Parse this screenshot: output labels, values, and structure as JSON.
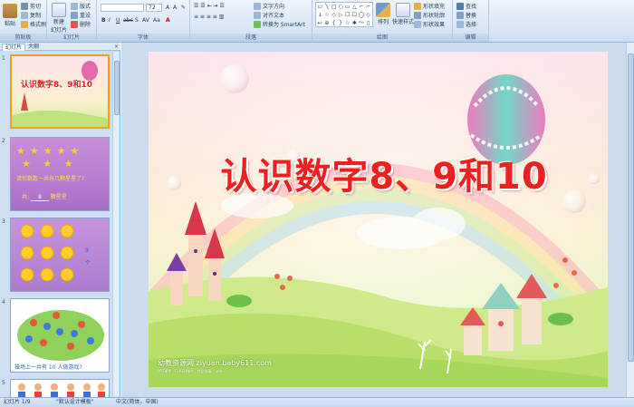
{
  "ribbon": {
    "clipboard": {
      "paste": "粘贴",
      "cut": "剪切",
      "copy": "复制",
      "format_painter": "格式刷",
      "label": "剪贴板"
    },
    "slides": {
      "new_slide": "新建",
      "new_slide2": "幻灯片",
      "layout": "版式",
      "reset": "重设",
      "delete": "删除",
      "label": "幻灯片"
    },
    "font": {
      "font_size": "72",
      "label": "字体"
    },
    "paragraph": {
      "text_direction": "文字方向",
      "align_text": "对齐文本",
      "smartart": "转换为 SmartArt",
      "label": "段落"
    },
    "drawing": {
      "shapes": [
        "▭",
        "╲",
        "□",
        "○",
        "▭",
        "△",
        "⌐",
        "⌐",
        "↓",
        "☆",
        "◇",
        "▷",
        "☐",
        "☐",
        "◯",
        "◇",
        "↩",
        "⊕",
        "{",
        "}",
        "☆",
        "✱",
        "〜",
        "▯"
      ],
      "arrange": "排列",
      "quick_styles": "快速样式",
      "shape_fill": "形状填充",
      "shape_outline": "形状轮廓",
      "shape_effects": "形状效果",
      "label": "绘图"
    },
    "editing": {
      "find": "查找",
      "replace": "替换",
      "select": "选择",
      "label": "编辑"
    }
  },
  "panel": {
    "tabs": [
      "幻灯片",
      "大纲"
    ],
    "close": "×",
    "slides": [
      {
        "num": "1",
        "title": "认识数字8、9和10"
      },
      {
        "num": "2",
        "caption": "请你数数一共有几颗星星了?",
        "answer_label": "共:",
        "answer": "8",
        "unit": "颗星星"
      },
      {
        "num": "3",
        "side1": "9",
        "side2": "个"
      },
      {
        "num": "4",
        "caption": "操场上一共有 10 人做游戏?"
      },
      {
        "num": "5"
      }
    ]
  },
  "slide": {
    "title": "认识数字8、9和10",
    "watermark": "幼教资源网 ziyuan.baby611.com",
    "watermark_sub": "PPT课件 · FLASH课件 · 教案故事 · 试卷"
  },
  "statusbar": {
    "slide_counter": "幻灯片 1/9",
    "theme": "\"默认设计模板\"",
    "language": "中文(简体，中国)"
  },
  "colors": {
    "ribbon_bg": "#dbe8f6",
    "title_red": "#ee1f1f",
    "selected_border": "#f0a020"
  }
}
